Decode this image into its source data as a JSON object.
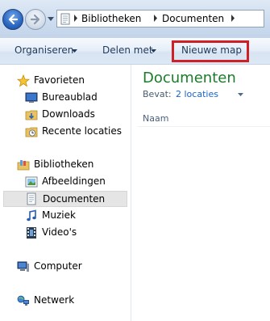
{
  "address_bar": {
    "breadcrumbs": [
      "Bibliotheken",
      "Documenten"
    ]
  },
  "toolbar": {
    "organize_label": "Organiseren",
    "share_label": "Delen met",
    "new_folder_label": "Nieuwe map"
  },
  "sidebar": {
    "favorites": {
      "header": "Favorieten",
      "items": [
        {
          "label": "Bureaublad",
          "icon": "desktop-icon"
        },
        {
          "label": "Downloads",
          "icon": "downloads-folder-icon"
        },
        {
          "label": "Recente locaties",
          "icon": "recent-places-icon"
        }
      ]
    },
    "libraries": {
      "header": "Bibliotheken",
      "items": [
        {
          "label": "Afbeeldingen",
          "icon": "pictures-icon"
        },
        {
          "label": "Documenten",
          "icon": "document-icon",
          "selected": true
        },
        {
          "label": "Muziek",
          "icon": "music-icon"
        },
        {
          "label": "Video's",
          "icon": "video-icon"
        }
      ]
    },
    "computer": {
      "label": "Computer"
    },
    "network": {
      "label": "Netwerk"
    }
  },
  "content": {
    "title": "Documenten",
    "includes_label": "Bevat:",
    "includes_link": "2 locaties",
    "column_name": "Naam"
  },
  "colors": {
    "accent_title": "#1a7c2a",
    "link": "#1b63c6",
    "highlight_box": "#cf2027",
    "toolbar_text": "#1e395b"
  }
}
